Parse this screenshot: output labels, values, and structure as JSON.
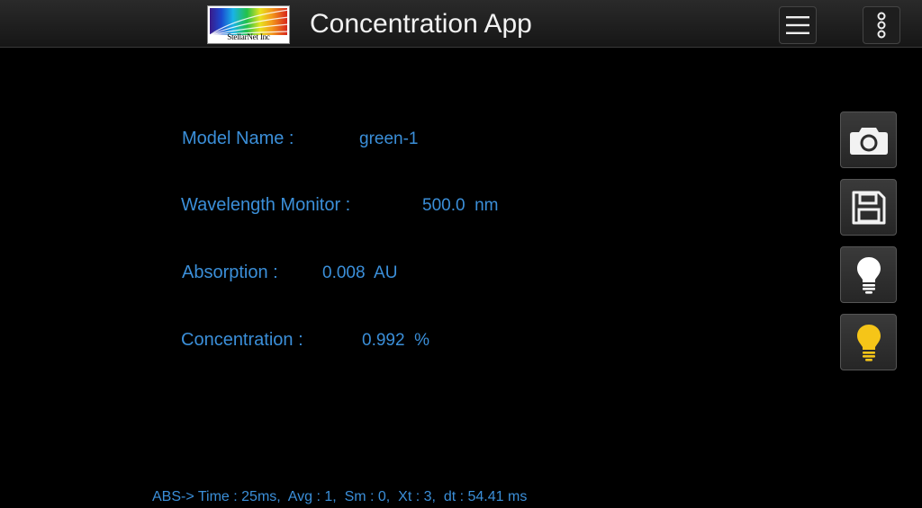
{
  "header": {
    "logo_text": "StellarNet Inc",
    "title": "Concentration App",
    "menu_icon": "hamburger-menu-icon",
    "more_icon": "vertical-dots-icon"
  },
  "fields": {
    "model_name": {
      "label": "Model Name :",
      "value": "green-1"
    },
    "wavelength": {
      "label": "Wavelength Monitor :",
      "value": "500.0  nm"
    },
    "absorption": {
      "label": "Absorption :",
      "value": "0.008  AU"
    },
    "concentration": {
      "label": "Concentration :",
      "value": "0.992  %"
    }
  },
  "side_buttons": {
    "capture_icon": "camera-icon",
    "save_icon": "floppy-disk-icon",
    "dark_icon": "lightbulb-white-icon",
    "light_icon": "lightbulb-yellow-icon"
  },
  "status": {
    "text": "ABS-> Time : 25ms,  Avg : 1,  Sm : 0,  Xt : 3,  dt : 54.41 ms"
  },
  "colors": {
    "text_blue": "#3b8fd9",
    "bulb_yellow": "#f5c518",
    "bulb_white": "#ffffff",
    "background": "#000000"
  }
}
